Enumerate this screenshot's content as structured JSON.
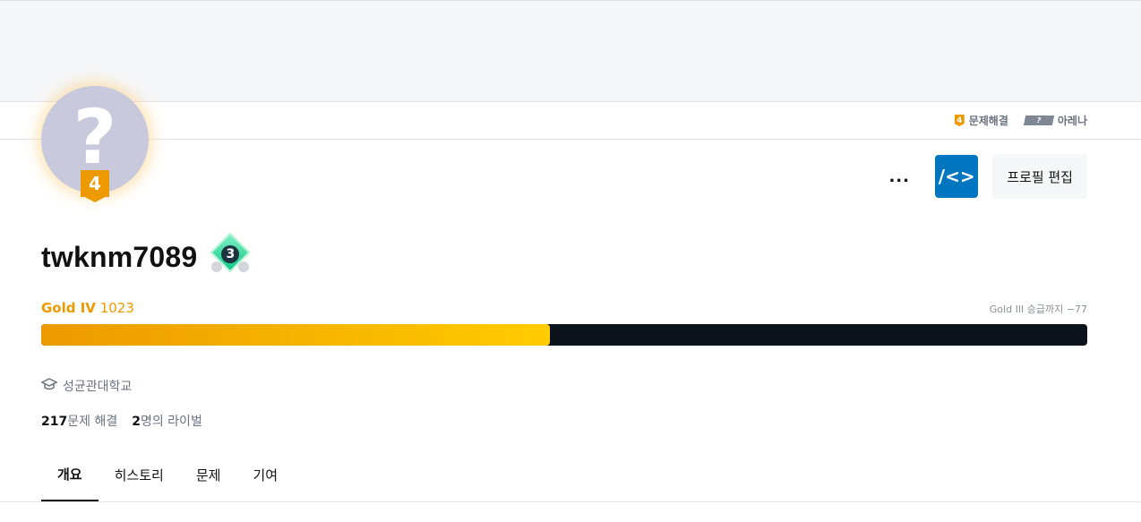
{
  "header": {
    "badges": [
      {
        "icon": "tier-shield-icon",
        "badge": "4",
        "label": "문제해결"
      },
      {
        "icon": "arena-tag-icon",
        "badge": "?",
        "label": "아레나"
      }
    ]
  },
  "avatar": {
    "placeholder": "?",
    "tier_badge": "4"
  },
  "actions": {
    "more": "...",
    "code": "/<>",
    "edit": "프로필 편집"
  },
  "profile": {
    "handle": "twknm7089",
    "class_level": "3",
    "tier_name": "Gold IV",
    "rating": "1023",
    "promotion_text": "Gold III 승급까지 −77",
    "progress": 0.486,
    "school": "성균관대학교",
    "solved_count": "217",
    "solved_label": "문제 해결",
    "rival_count": "2",
    "rival_label": "명의 라이벌"
  },
  "tabs": [
    {
      "label": "개요",
      "active": true
    },
    {
      "label": "히스토리",
      "active": false
    },
    {
      "label": "문제",
      "active": false
    },
    {
      "label": "기여",
      "active": false
    }
  ],
  "colors": {
    "gold": "#ec9a00",
    "gold_light": "#ffcc00",
    "code_button": "#0076c0",
    "bar_bg": "#0d131b"
  }
}
